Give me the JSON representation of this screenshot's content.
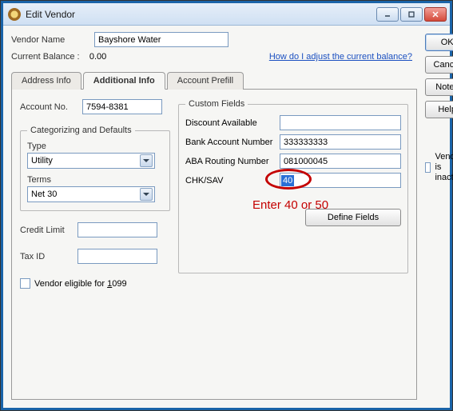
{
  "window": {
    "title": "Edit Vendor"
  },
  "buttons": {
    "ok": "OK",
    "cancel": "Cancel",
    "notes": "Notes",
    "help": "Help",
    "define_fields": "Define Fields"
  },
  "header": {
    "vendor_name_label": "Vendor Name",
    "vendor_name_value": "Bayshore Water",
    "current_balance_label": "Current Balance :",
    "current_balance_value": "0.00",
    "balance_link": "How do I adjust the current balance?"
  },
  "tabs": {
    "address": "Address Info",
    "additional": "Additional Info",
    "prefill": "Account Prefill"
  },
  "additional": {
    "account_no_label": "Account No.",
    "account_no_value": "7594-8381",
    "categorizing_legend": "Categorizing and Defaults",
    "type_label": "Type",
    "type_value": "Utility",
    "terms_label": "Terms",
    "terms_value": "Net 30",
    "credit_limit_label": "Credit Limit",
    "credit_limit_value": "",
    "tax_id_label": "Tax ID",
    "tax_id_value": "",
    "eligible_1099_label": "Vendor eligible for 1099",
    "custom_legend": "Custom Fields",
    "discount_label": "Discount Available",
    "discount_value": "",
    "bank_acct_label": "Bank Account Number",
    "bank_acct_value": "333333333",
    "aba_label": "ABA Routing Number",
    "aba_value": "081000045",
    "chksav_label": "CHK/SAV",
    "chksav_value": "40"
  },
  "inactive_label": "Vendor is inactive",
  "annotation": {
    "text": "Enter 40 or 50"
  }
}
